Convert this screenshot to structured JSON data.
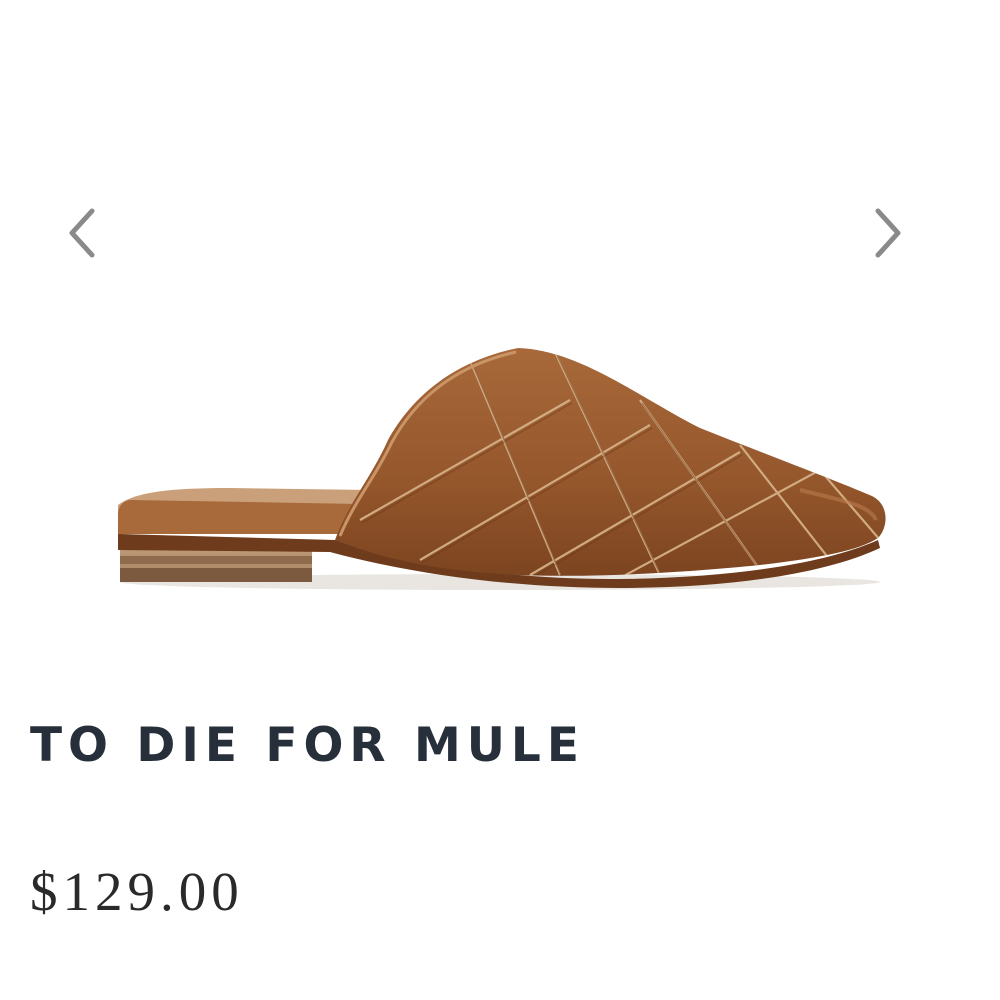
{
  "product": {
    "title": "TO DIE FOR MULE",
    "price": "$129.00"
  },
  "gallery": {
    "prev_icon": "chevron-left-icon",
    "next_icon": "chevron-right-icon",
    "image": "brown-woven-leather-mule-shoe"
  },
  "colors": {
    "title": "#27303a",
    "price": "#2a2a2a",
    "arrow": "#8a8a8a",
    "leather": "#9a5a2e"
  }
}
